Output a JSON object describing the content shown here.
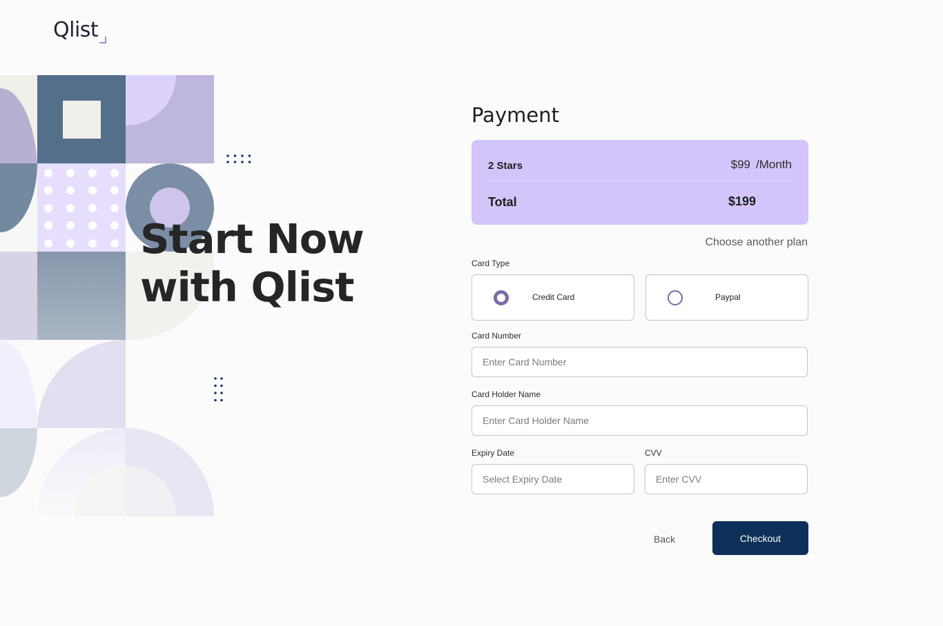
{
  "brand": {
    "logo": "Qlist"
  },
  "hero": {
    "line1": "Start Now",
    "line2": "with Qlist"
  },
  "payment": {
    "title": "Payment",
    "plan": {
      "name": "2 Stars",
      "price": "$99",
      "period": "/Month"
    },
    "total": {
      "label": "Total",
      "value": "$199"
    },
    "choose_another": "Choose another plan",
    "card_type": {
      "label": "Card Type",
      "options": [
        {
          "label": "Credit Card",
          "selected": true
        },
        {
          "label": "Paypal",
          "selected": false
        }
      ]
    },
    "card_number": {
      "label": "Card Number",
      "placeholder": "Enter Card Number"
    },
    "card_holder": {
      "label": "Card Holder Name",
      "placeholder": "Enter Card Holder Name"
    },
    "expiry": {
      "label": "Expiry Date",
      "placeholder": "Select Expiry Date"
    },
    "cvv": {
      "label": "CVV",
      "placeholder": "Enter CVV"
    },
    "back_label": "Back",
    "checkout_label": "Checkout"
  },
  "colors": {
    "accent": "#0e2f57",
    "summary_bg": "#d3c5fa",
    "radio": "#7c6aa8"
  }
}
